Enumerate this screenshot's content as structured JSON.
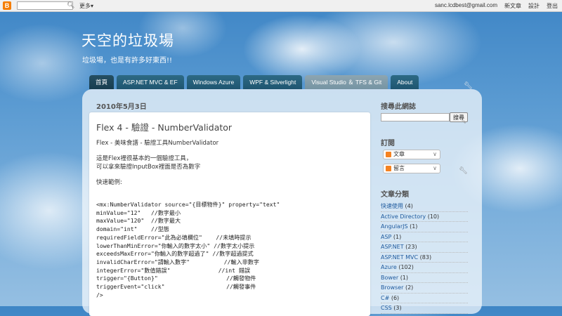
{
  "navbar": {
    "logo": "B",
    "search_button_icon": "search-icon",
    "more_label": "更多▾",
    "email": "sanc.lcdbest@gmail.com",
    "new_post": "新文章",
    "design": "設計",
    "sign_out": "登出"
  },
  "header": {
    "title": "天空的垃圾場",
    "description": "垃圾場，也是有許多好東西!!"
  },
  "tabs": [
    {
      "label": "首頁"
    },
    {
      "label": "ASP.NET MVC & EF"
    },
    {
      "label": "Windows Azure"
    },
    {
      "label": "WPF & Silverlight"
    },
    {
      "label": "Visual Studio ＆ TFS & Git"
    },
    {
      "label": "About"
    }
  ],
  "post": {
    "date": "2010年5月3日",
    "title": "Flex 4 - 驗證 - NumberValidator",
    "lines": [
      "Flex - 美味食譜 -  驗證工具NumberValidator",
      "這是Flex裡很基本的一個驗證工具，",
      "可以拿來驗證InputBox裡面是否為數字",
      "快速範例:"
    ],
    "code": "<mx:NumberValidator source=\"{目標物件}\" property=\"text\"\nminValue=\"12\"   //數字最小\nmaxValue=\"120\"  //數字最大\ndomain=\"int\"    //型態\nrequiredFieldError=\"此為必填欄位\"    //未填時提示\nlowerThanMinError=\"你輸入的數字太小\" //數字太小提示\nexceedsMaxError=\"你輸入的數字超過了\" //數字超過提式\ninvalidCharError=\"請輸入數字\"          //輸入非數字\nintegerError=\"數值錯誤\"              //int 錯誤\ntrigger=\"{Button}\"                    //觸發物件\ntriggerEvent=\"click\"                  //觸發事件\n/>"
  },
  "sidebar": {
    "search_heading": "搜尋此網誌",
    "search_button": "搜尋",
    "subscribe_heading": "訂閱",
    "subscribe_items": [
      "文章",
      "留言"
    ],
    "labels_heading": "文章分類",
    "labels": [
      {
        "name": "快速使用",
        "count": "(4)"
      },
      {
        "name": "Active Directory",
        "count": "(10)"
      },
      {
        "name": "AngularJS",
        "count": "(1)"
      },
      {
        "name": "ASP",
        "count": "(1)"
      },
      {
        "name": "ASP.NET",
        "count": "(23)"
      },
      {
        "name": "ASP.NET MVC",
        "count": "(83)"
      },
      {
        "name": "Azure",
        "count": "(102)"
      },
      {
        "name": "Bower",
        "count": "(1)"
      },
      {
        "name": "Browser",
        "count": "(2)"
      },
      {
        "name": "C#",
        "count": "(6)"
      },
      {
        "name": "CSS",
        "count": "(3)"
      }
    ]
  },
  "colors": {
    "tab_bg": "#1f5570",
    "tab_light": "#8da5b1",
    "label_link": "#1e5a9e",
    "rss": "#f58220",
    "blogger": "#f57d00"
  }
}
